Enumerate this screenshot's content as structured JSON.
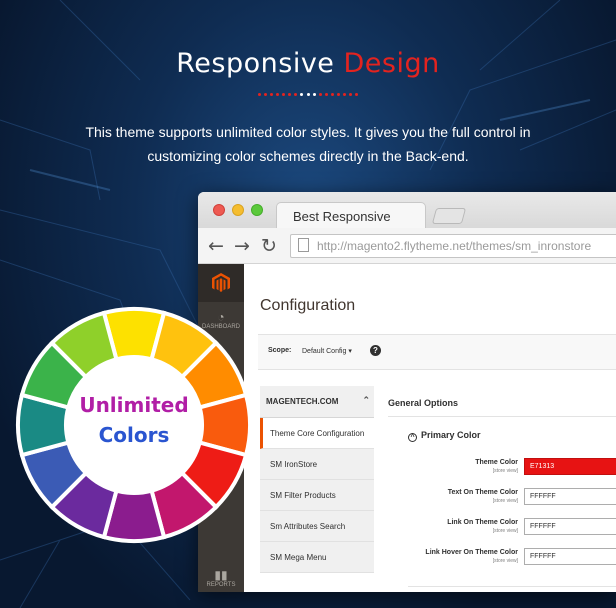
{
  "hero": {
    "title_main": "Responsive",
    "title_accent": "Design",
    "subtitle_line1": "This theme supports unlimited color styles. It gives you the full control in",
    "subtitle_line2": "customizing color schemes directly in the Back-end."
  },
  "colors": {
    "accent": "#e3231f",
    "magento_orange": "#eb5202",
    "theme_color_value": "#E71313"
  },
  "browser": {
    "tab_title": "Best Responsive",
    "url": "http://magento2.flytheme.net/themes/sm_inronstore",
    "buttons": [
      "back-arrow-icon",
      "forward-arrow-icon",
      "reload-icon"
    ]
  },
  "admin": {
    "sidebar": {
      "dashboard_label": "DASHBOARD",
      "reports_label": "REPORTS"
    },
    "page_title": "Configuration",
    "scope_label": "Scope:",
    "scope_value": "Default Config",
    "scope_caret": "▾",
    "nav_group": "MAGENTECH.COM",
    "nav_items": [
      "Theme Core Configuration",
      "SM IronStore",
      "SM Filter Products",
      "Sm Attributes Search",
      "SM Mega Menu"
    ],
    "section_title": "General Options",
    "group_title": "Primary Color",
    "fields": [
      {
        "label": "Theme Color",
        "scope": "[store view]",
        "value": "E71313"
      },
      {
        "label": "Text On Theme Color",
        "scope": "[store view]",
        "value": "FFFFFF"
      },
      {
        "label": "Link On Theme Color",
        "scope": "[store view]",
        "value": "FFFFFF"
      },
      {
        "label": "Link Hover On Theme Color",
        "scope": "[store view]",
        "value": "FFFFFF"
      }
    ]
  },
  "wheel": {
    "line1": "Unlimited",
    "line2": "Colors",
    "segment_colors": [
      "#fde100",
      "#ffc20e",
      "#ff8c00",
      "#f95b0d",
      "#ee1c16",
      "#c2176d",
      "#8b1c8e",
      "#6b2a9e",
      "#3b5bb5",
      "#1a8a84",
      "#3bb34a",
      "#8fd02a"
    ]
  }
}
